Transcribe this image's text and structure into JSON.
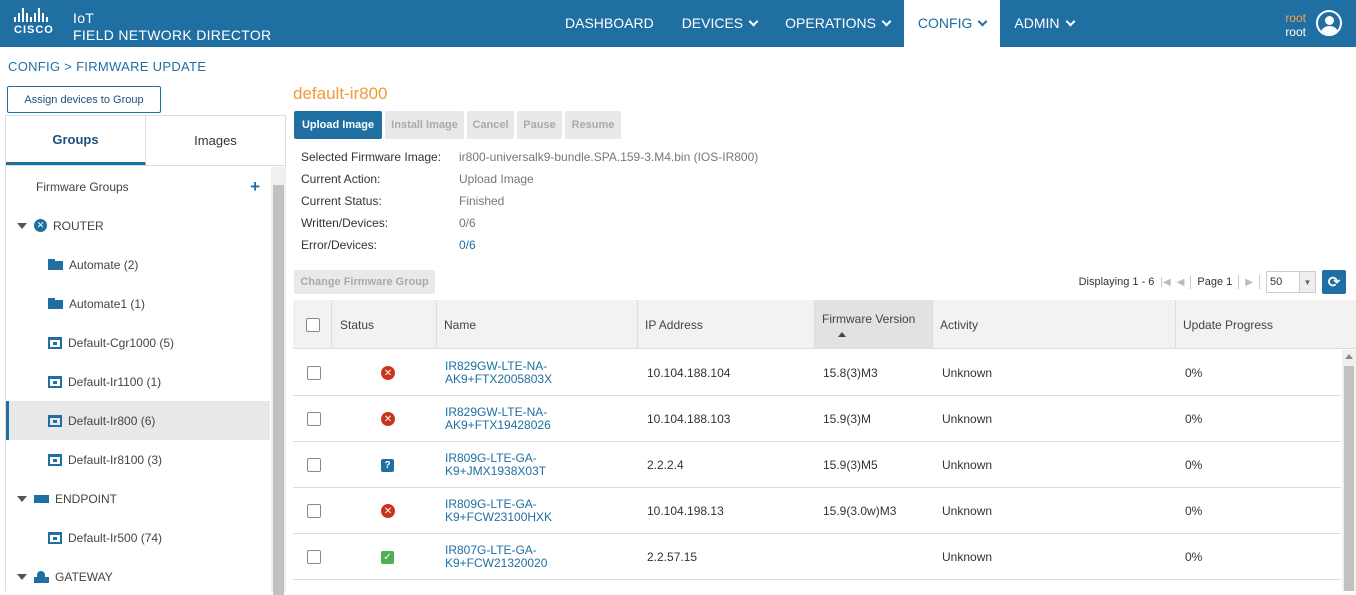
{
  "header": {
    "brand": "CISCO",
    "app_title_line1": "IoT",
    "app_title_line2": "FIELD NETWORK DIRECTOR",
    "nav": [
      {
        "label": "DASHBOARD"
      },
      {
        "label": "DEVICES"
      },
      {
        "label": "OPERATIONS"
      },
      {
        "label": "CONFIG"
      },
      {
        "label": "ADMIN"
      }
    ],
    "user_name": "root",
    "user_role": "root"
  },
  "breadcrumb": "CONFIG > FIRMWARE UPDATE",
  "left": {
    "assign_button": "Assign devices to Group",
    "tabs": [
      "Groups",
      "Images"
    ],
    "firmware_groups_label": "Firmware Groups",
    "tree": {
      "router_label": "ROUTER",
      "router_groups": [
        "Automate (2)",
        "Automate1 (1)",
        "Default-Cgr1000 (5)",
        "Default-Ir1100 (1)",
        "Default-Ir800 (6)",
        "Default-Ir8100 (3)"
      ],
      "endpoint_label": "ENDPOINT",
      "endpoint_groups": [
        "Default-Ir500 (74)"
      ],
      "gateway_label": "GATEWAY"
    }
  },
  "main": {
    "group_title": "default-ir800",
    "buttons": {
      "upload": "Upload Image",
      "install": "Install Image",
      "cancel": "Cancel",
      "pause": "Pause",
      "resume": "Resume",
      "change_group": "Change Firmware Group"
    },
    "info": {
      "selected_image_label": "Selected Firmware Image:",
      "selected_image_value": "ir800-universalk9-bundle.SPA.159-3.M4.bin (IOS-IR800)",
      "current_action_label": "Current Action:",
      "current_action_value": "Upload Image",
      "current_status_label": "Current Status:",
      "current_status_value": "Finished",
      "written_label": "Written/Devices:",
      "written_value": "0/6",
      "error_label": "Error/Devices:",
      "error_value": "0/6"
    },
    "pager": {
      "displaying": "Displaying 1 - 6",
      "page": "Page 1",
      "page_size": "50"
    },
    "table": {
      "headers": {
        "status": "Status",
        "name": "Name",
        "ip": "IP Address",
        "firmware": "Firmware Version",
        "activity": "Activity",
        "progress": "Update Progress"
      },
      "rows": [
        {
          "status": "error",
          "name_l1": "IR829GW-LTE-NA-",
          "name_l2": "AK9+FTX2005803X",
          "ip": "10.104.188.104",
          "firmware": "15.8(3)M3",
          "activity": "Unknown",
          "progress": "0%"
        },
        {
          "status": "error",
          "name_l1": "IR829GW-LTE-NA-",
          "name_l2": "AK9+FTX19428026",
          "ip": "10.104.188.103",
          "firmware": "15.9(3)M",
          "activity": "Unknown",
          "progress": "0%"
        },
        {
          "status": "unknown",
          "name_l1": "IR809G-LTE-GA-",
          "name_l2": "K9+JMX1938X03T",
          "ip": "2.2.2.4",
          "firmware": "15.9(3)M5",
          "activity": "Unknown",
          "progress": "0%"
        },
        {
          "status": "error",
          "name_l1": "IR809G-LTE-GA-",
          "name_l2": "K9+FCW23100HXK",
          "ip": "10.104.198.13",
          "firmware": "15.9(3.0w)M3",
          "activity": "Unknown",
          "progress": "0%"
        },
        {
          "status": "ok",
          "name_l1": "IR807G-LTE-GA-",
          "name_l2": "K9+FCW21320020",
          "ip": "2.2.57.15",
          "firmware": "",
          "activity": "Unknown",
          "progress": "0%"
        }
      ]
    }
  },
  "colors": {
    "header_bg": "#1f6fa3",
    "accent_orange": "#f29a38",
    "error_red": "#c8341c",
    "ok_green": "#4caf50"
  }
}
